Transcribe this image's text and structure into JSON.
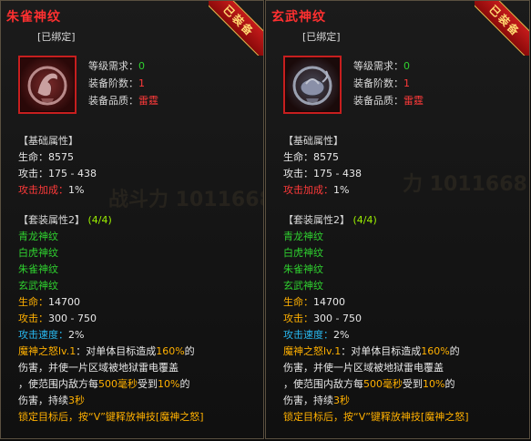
{
  "cards": [
    {
      "title": "朱雀神纹",
      "bound": "[已绑定]",
      "badge": "已装备",
      "level_req_label": "等级需求：",
      "level_req_value": "0",
      "tier_label": "装备阶数：",
      "tier_value": "1",
      "quality_label": "装备品质：",
      "quality_value": "雷霆",
      "base_title": "【基础属性】",
      "hp_label": "生命：",
      "hp_value": "8575",
      "atk_label": "攻击：",
      "atk_value": "175 - 438",
      "atkbonus_label": "攻击加成：",
      "atkbonus_value": "1%",
      "set_title": "【套装属性2】",
      "set_count": "(4/4)",
      "set_items": [
        "青龙神纹",
        "白虎神纹",
        "朱雀神纹",
        "玄武神纹"
      ],
      "set_hp_label": "生命：",
      "set_hp_value": "14700",
      "set_atk_label": "攻击：",
      "set_atk_value": "300 - 750",
      "set_spd_label": "攻击速度：",
      "set_spd_value": "2%",
      "skill_name": "魔神之怒",
      "skill_lv": "lv.1",
      "skill_t1": "：对单体目标造成",
      "skill_pct": "160%",
      "skill_t2": "的",
      "skill_line2": "伤害，并使一片区域被地狱雷电覆盖",
      "skill_line3a": "，使范围内敌方每",
      "skill_ms": "500毫秒",
      "skill_line3b": "受到",
      "skill_pct2": "10%",
      "skill_line3c": "的",
      "skill_line4a": "伤害，持续",
      "skill_sec": "3秒",
      "hint": "锁定目标后，按“V”键释放神技[魔神之怒]",
      "watermark": "战斗力 1011668"
    },
    {
      "title": "玄武神纹",
      "bound": "[已绑定]",
      "badge": "已装备",
      "level_req_label": "等级需求：",
      "level_req_value": "0",
      "tier_label": "装备阶数：",
      "tier_value": "1",
      "quality_label": "装备品质：",
      "quality_value": "雷霆",
      "base_title": "【基础属性】",
      "hp_label": "生命：",
      "hp_value": "8575",
      "atk_label": "攻击：",
      "atk_value": "175 - 438",
      "atkbonus_label": "攻击加成：",
      "atkbonus_value": "1%",
      "set_title": "【套装属性2】",
      "set_count": "(4/4)",
      "set_items": [
        "青龙神纹",
        "白虎神纹",
        "朱雀神纹",
        "玄武神纹"
      ],
      "set_hp_label": "生命：",
      "set_hp_value": "14700",
      "set_atk_label": "攻击：",
      "set_atk_value": "300 - 750",
      "set_spd_label": "攻击速度：",
      "set_spd_value": "2%",
      "skill_name": "魔神之怒",
      "skill_lv": "lv.1",
      "skill_t1": "：对单体目标造成",
      "skill_pct": "160%",
      "skill_t2": "的",
      "skill_line2": "伤害，并使一片区域被地狱雷电覆盖",
      "skill_line3a": "，使范围内敌方每",
      "skill_ms": "500毫秒",
      "skill_line3b": "受到",
      "skill_pct2": "10%",
      "skill_line3c": "的",
      "skill_line4a": "伤害，持续",
      "skill_sec": "3秒",
      "hint": "锁定目标后，按“V”键释放神技[魔神之怒]",
      "watermark": "力 1011668"
    }
  ]
}
